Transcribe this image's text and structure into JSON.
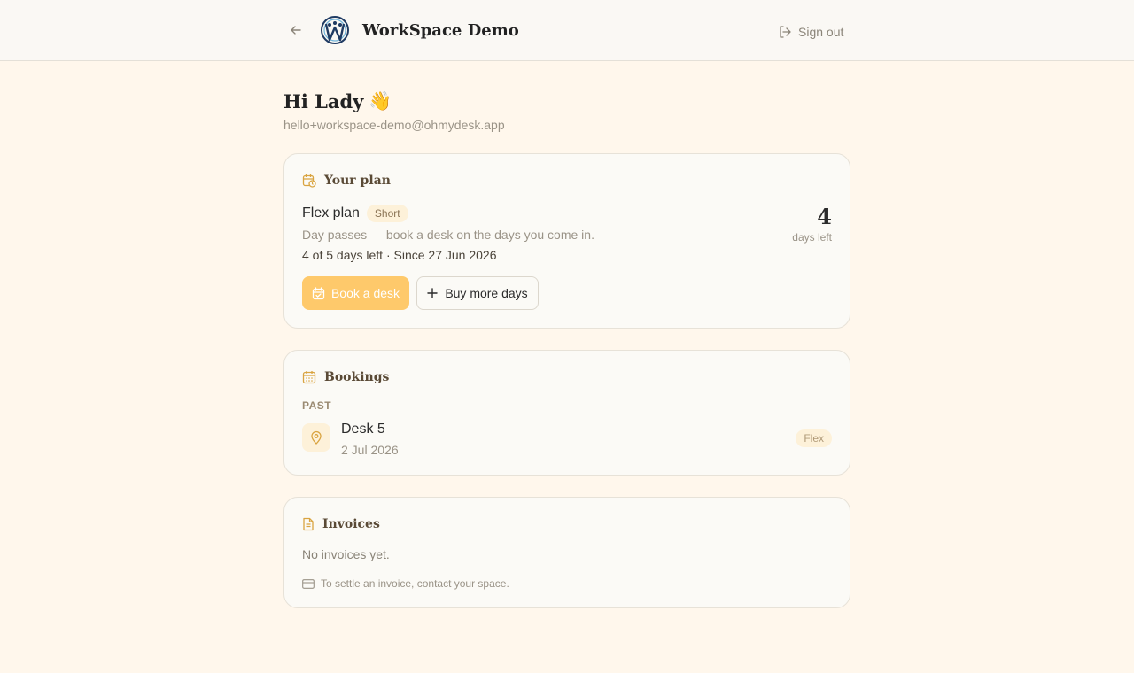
{
  "header": {
    "brand": "WorkSpace Demo",
    "signout_label": "Sign out"
  },
  "user": {
    "greeting": "Hi Lady",
    "wave_emoji": "👋",
    "email": "hello+workspace-demo@ohmydesk.app"
  },
  "plan": {
    "section_title": "Your plan",
    "name": "Flex plan",
    "badge": "Short",
    "description": "Day passes — book a desk on the days you come in.",
    "usage": "4 of 5 days left · Since 27 Jun 2026",
    "days_left_value": "4",
    "days_left_label": "days left",
    "book_button": "Book a desk",
    "buy_button": "Buy more days"
  },
  "bookings": {
    "section_title": "Bookings",
    "past_label": "PAST",
    "items": [
      {
        "desk": "Desk 5",
        "date": "2 Jul 2026",
        "tag": "Flex"
      }
    ]
  },
  "invoices": {
    "section_title": "Invoices",
    "empty_text": "No invoices yet.",
    "settle_note": "To settle an invoice, contact your space."
  },
  "colors": {
    "page_bg": "#fff7ec",
    "accent": "#fec96b",
    "icon_accent": "#d9a441",
    "pill_bg": "#fdf1d9"
  }
}
